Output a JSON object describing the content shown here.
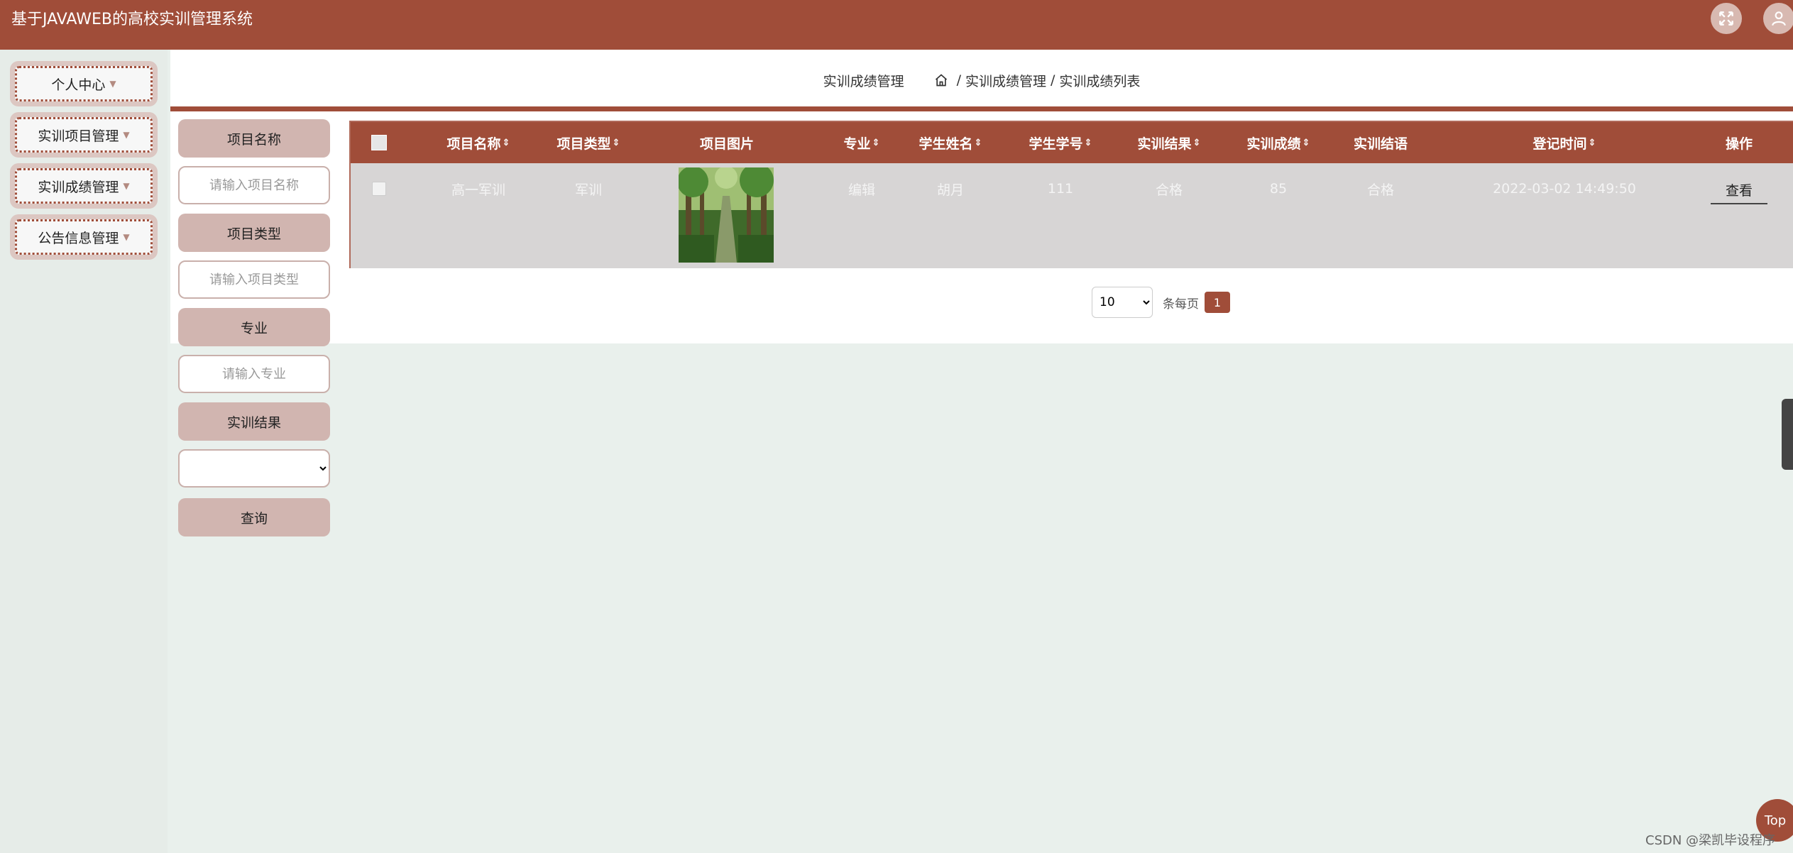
{
  "header": {
    "title": "基于JAVAWEB的高校实训管理系统"
  },
  "sidebar": {
    "items": [
      {
        "label": "个人中心"
      },
      {
        "label": "实训项目管理"
      },
      {
        "label": "实训成绩管理"
      },
      {
        "label": "公告信息管理"
      }
    ]
  },
  "breadcrumb": {
    "title": "实训成绩管理",
    "path": [
      "实训成绩管理",
      "实训成绩列表"
    ],
    "separator": "/"
  },
  "search": {
    "project_name_label": "项目名称",
    "project_name_placeholder": "请输入项目名称",
    "project_type_label": "项目类型",
    "project_type_placeholder": "请输入项目类型",
    "major_label": "专业",
    "major_placeholder": "请输入专业",
    "result_label": "实训结果",
    "result_value": "",
    "query_button": "查询"
  },
  "table": {
    "columns": [
      "项目名称",
      "项目类型",
      "项目图片",
      "专业",
      "学生姓名",
      "学生学号",
      "实训结果",
      "实训成绩",
      "实训结语",
      "登记时间",
      "操作"
    ],
    "sortable_icon": "⇕",
    "rows": [
      {
        "project_name": "高一军训",
        "project_type": "军训",
        "image_icon": "tree-path-photo",
        "major": "编辑",
        "student_name": "胡月",
        "student_id": "111",
        "result": "合格",
        "score": "85",
        "summary": "合格",
        "time": "2022-03-02 14:49:50",
        "action": "查看"
      }
    ]
  },
  "pagination": {
    "page_size": "10",
    "per_page_label": "条每页",
    "current_page": "1"
  },
  "top_button": "Top",
  "watermark": "CSDN @梁凯毕设程序",
  "colors": {
    "primary": "#a04d39",
    "label_bg": "#d1b5b0",
    "row_bg": "#d7d5d5",
    "page_bg": "#e9f0ec"
  }
}
